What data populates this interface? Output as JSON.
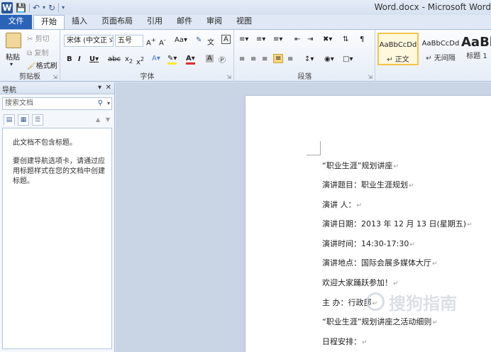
{
  "window": {
    "title": "Word.docx - Microsoft Word"
  },
  "qat": {
    "app_icon": "W",
    "save": "save-icon",
    "undo": "undo-icon",
    "redo": "redo-icon"
  },
  "tabs": [
    {
      "label": "文件"
    },
    {
      "label": "开始"
    },
    {
      "label": "插入"
    },
    {
      "label": "页面布局"
    },
    {
      "label": "引用"
    },
    {
      "label": "邮件"
    },
    {
      "label": "审阅"
    },
    {
      "label": "视图"
    }
  ],
  "ribbon": {
    "clipboard": {
      "label": "剪贴板",
      "paste": "粘贴",
      "cut": "剪切",
      "copy": "复制",
      "format_painter": "格式刷"
    },
    "font": {
      "label": "字体",
      "font_name": "宋体 (中文正ゞ",
      "font_size": "五号"
    },
    "paragraph": {
      "label": "段落"
    },
    "styles": [
      {
        "sample": "AaBbCcDd",
        "name": "正文"
      },
      {
        "sample": "AaBbCcDd",
        "name": "无间隔"
      },
      {
        "sample": "AaBl",
        "name": "标题 1"
      }
    ]
  },
  "nav": {
    "title": "导航",
    "search_placeholder": "搜索文档",
    "msg1": "此文档不包含标题。",
    "msg2": "要创建导航选项卡，请通过应用标题样式在您的文档中创建标题。"
  },
  "document": {
    "lines": [
      "“职业生涯”规划讲座",
      "演讲题目：职业生涯规划",
      "演讲  人：",
      "演讲日期：2013 年 12 月 13 日(星期五)",
      "演讲时间：14:30-17:30",
      "演讲地点：国际会展多媒体大厅",
      "欢迎大家踊跃参加！",
      "主  办：行政部",
      "“职业生涯”规划讲座之活动细则",
      "日程安排："
    ]
  },
  "watermark": "搜狗指南",
  "colors": {
    "file_tab": "#2a63b8",
    "ribbon_bg": "#e6edf7",
    "doc_bg": "#c9d4e4"
  }
}
